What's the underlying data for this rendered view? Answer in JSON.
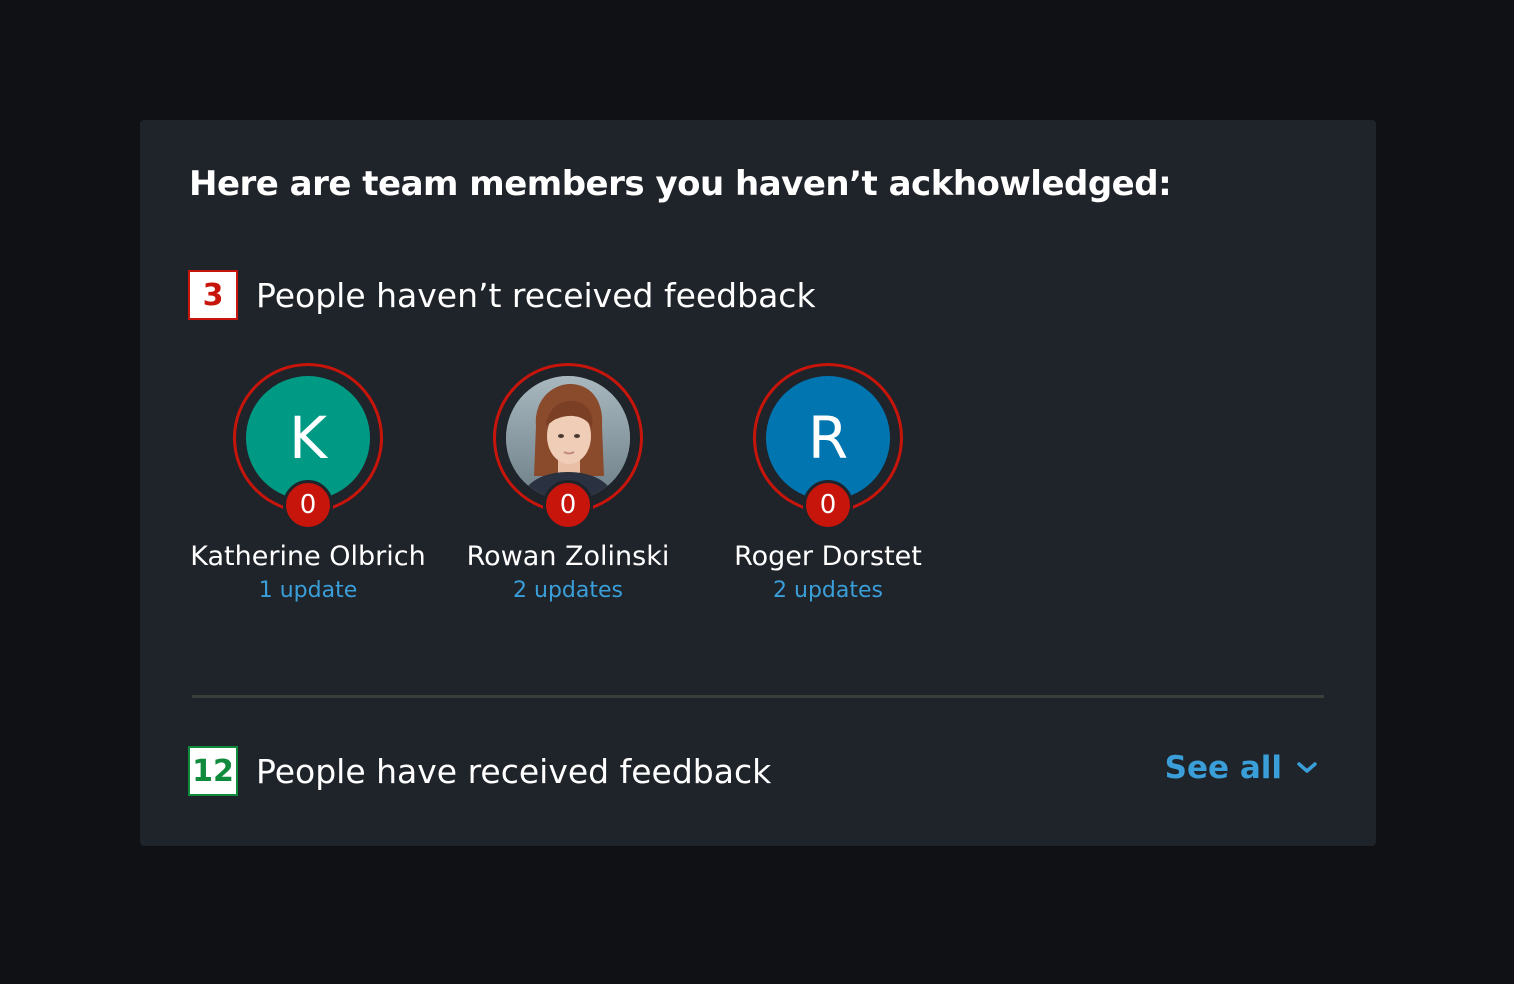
{
  "title": "Here are team members you haven’t ackhowledged:",
  "not_received": {
    "count": "3",
    "label": "People haven’t received feedback",
    "status_color": "#c8150b"
  },
  "members": [
    {
      "name": "Katherine Olbrich",
      "initial": "K",
      "avatar_color": "#009a84",
      "count": "0",
      "updates": "1 update"
    },
    {
      "name": "Rowan Zolinski",
      "initial": "",
      "avatar_type": "photo",
      "count": "0",
      "updates": "2 updates"
    },
    {
      "name": "Roger Dorstet",
      "initial": "R",
      "avatar_color": "#0075b0",
      "count": "0",
      "updates": "2 updates"
    }
  ],
  "received": {
    "count": "12",
    "label": "People have received feedback",
    "status_color": "#108a3c"
  },
  "see_all": {
    "label": "See all",
    "icon": "chevron-down-icon"
  },
  "colors": {
    "accent": "#3a9fd8",
    "card_bg": "#1f232a",
    "page_bg": "#0f1115"
  }
}
